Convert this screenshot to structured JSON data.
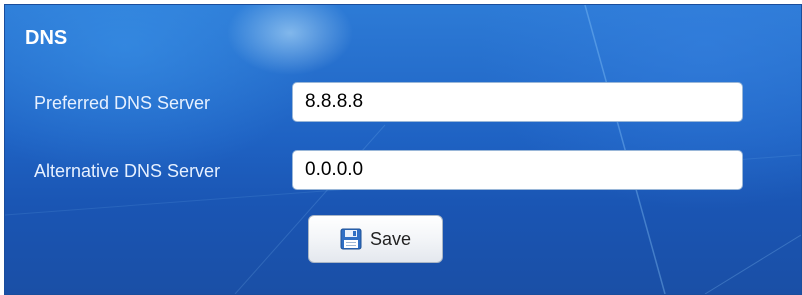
{
  "section": {
    "title": "DNS"
  },
  "fields": {
    "preferred_label": "Preferred DNS Server",
    "preferred_value": "8.8.8.8",
    "alternative_label": "Alternative DNS Server",
    "alternative_value": "0.0.0.0"
  },
  "actions": {
    "save_label": "Save",
    "save_icon": "floppy-disk-icon"
  },
  "colors": {
    "background": "#1f63c4",
    "label_text": "#e6f0ff",
    "field_background": "#ffffff"
  }
}
